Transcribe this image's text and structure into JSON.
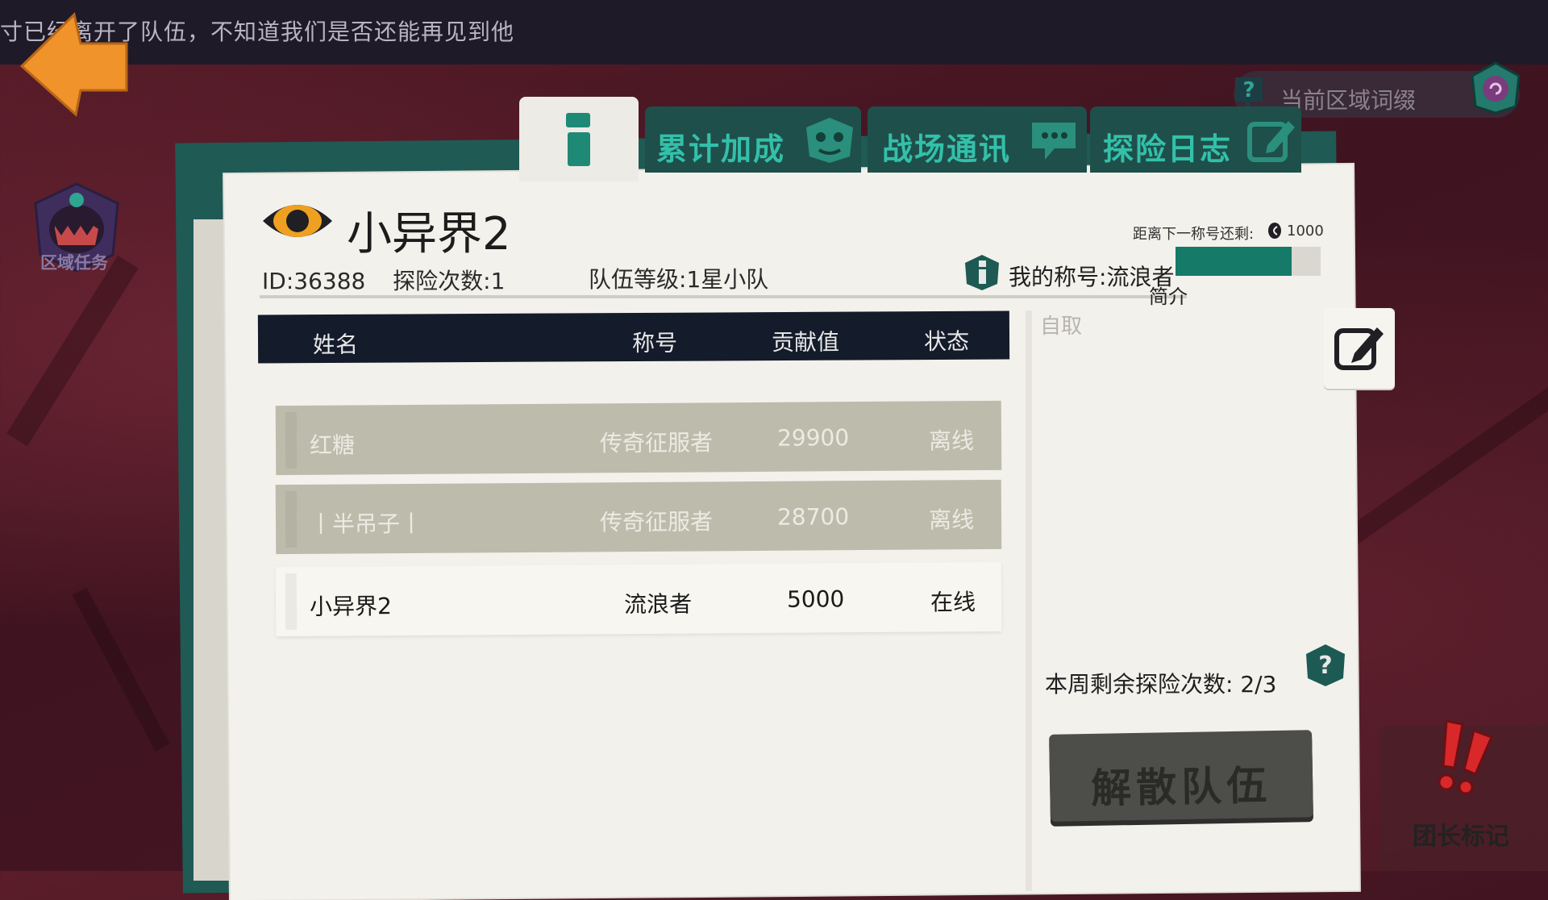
{
  "ticker": {
    "text": "寸已经离开了队伍，不知道我们是否还能再见到他"
  },
  "region": {
    "suffix_label": "当前区域词缀"
  },
  "region_task": {
    "label": "区域任务"
  },
  "tabs": [
    {
      "label": "累计加成",
      "icon": "monster-face-icon"
    },
    {
      "label": "战场通讯",
      "icon": "chat-bubble-icon"
    },
    {
      "label": "探险日志",
      "icon": "pencil-note-icon"
    }
  ],
  "team": {
    "name": "小异界2",
    "id_label": "ID:",
    "id": "36388",
    "explore_label": "探险次数:",
    "explore_count": "1",
    "level_label": "队伍等级:",
    "level": "1星小队"
  },
  "title_progress": {
    "next_label": "距离下一称号还剩:",
    "coins": "1000",
    "my_title_label": "我的称号:",
    "my_title": "流浪者",
    "fill_fraction": 0.8
  },
  "intro": {
    "label": "简介",
    "text": "自取"
  },
  "table": {
    "headers": {
      "name": "姓名",
      "title": "称号",
      "contribution": "贡献值",
      "status": "状态"
    },
    "rows": [
      {
        "name": "红糖",
        "title": "传奇征服者",
        "contribution": "29900",
        "status": "离线"
      },
      {
        "name": "丨半吊子丨",
        "title": "传奇征服者",
        "contribution": "28700",
        "status": "离线"
      },
      {
        "name": "小异界2",
        "title": "流浪者",
        "contribution": "5000",
        "status": "在线"
      }
    ]
  },
  "weekly": {
    "label": "本周剩余探险次数:",
    "value": "2/3"
  },
  "disband_label": "解散队伍",
  "leader_mark_label": "团长标记",
  "colors": {
    "accent": "#157a67",
    "tab_text": "#33c0aa",
    "panel_teal": "#1f5a55"
  }
}
